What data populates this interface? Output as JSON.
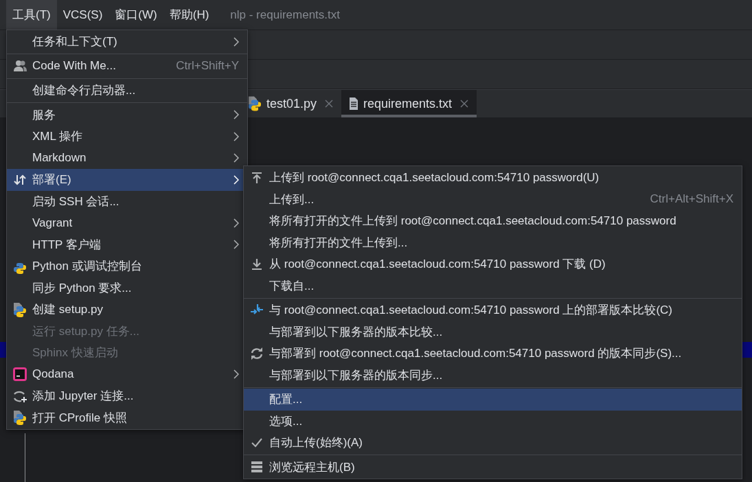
{
  "menu_bar": [
    {
      "label": "工具(T)",
      "selected": true
    },
    {
      "label": "VCS(S)",
      "selected": false
    },
    {
      "label": "窗口(W)",
      "selected": false
    },
    {
      "label": "帮助(H)",
      "selected": false
    }
  ],
  "window": {
    "title": "nlp - requirements.txt"
  },
  "tabs": [
    {
      "label": "test01.py",
      "selected": false
    },
    {
      "label": "requirements.txt",
      "selected": true
    }
  ],
  "tools_menu": {
    "groups": [
      [
        {
          "label": "任务和上下文(T)",
          "submenu": true,
          "disabled": false,
          "selected": false
        }
      ],
      [
        {
          "label": "Code With Me...",
          "shortcut": "Ctrl+Shift+Y",
          "submenu": false,
          "disabled": false,
          "selected": false
        }
      ],
      [
        {
          "label": "创建命令行启动器...",
          "submenu": false,
          "disabled": false,
          "selected": false
        }
      ],
      [
        {
          "label": "服务",
          "submenu": true,
          "disabled": false,
          "selected": false
        },
        {
          "label": "XML 操作",
          "submenu": true,
          "disabled": false,
          "selected": false
        },
        {
          "label": "Markdown",
          "submenu": true,
          "disabled": false,
          "selected": false
        },
        {
          "label": "部署(E)",
          "submenu": true,
          "disabled": false,
          "selected": true
        },
        {
          "label": "启动 SSH 会话...",
          "submenu": false,
          "disabled": false,
          "selected": false
        },
        {
          "label": "Vagrant",
          "submenu": true,
          "disabled": false,
          "selected": false
        },
        {
          "label": "HTTP 客户端",
          "submenu": true,
          "disabled": false,
          "selected": false
        },
        {
          "label": "Python 或调试控制台",
          "submenu": false,
          "disabled": false,
          "selected": false
        },
        {
          "label": "同步 Python 要求...",
          "submenu": false,
          "disabled": false,
          "selected": false
        },
        {
          "label": "创建 setup.py",
          "submenu": false,
          "disabled": false,
          "selected": false
        },
        {
          "label": "运行 setup.py 任务...",
          "submenu": false,
          "disabled": true,
          "selected": false
        },
        {
          "label": "Sphinx 快速启动",
          "submenu": false,
          "disabled": true,
          "selected": false
        },
        {
          "label": "Qodana",
          "submenu": true,
          "disabled": false,
          "selected": false
        },
        {
          "label": "添加 Jupyter 连接...",
          "submenu": false,
          "disabled": false,
          "selected": false
        },
        {
          "label": "打开 CProfile 快照",
          "submenu": false,
          "disabled": false,
          "selected": false
        }
      ]
    ]
  },
  "deployment_submenu": {
    "groups": [
      [
        {
          "label": "上传到 root@connect.cqa1.seetacloud.com:54710 password(U)",
          "checked": false,
          "selected": false
        },
        {
          "label": "上传到...",
          "shortcut": "Ctrl+Alt+Shift+X",
          "checked": false,
          "selected": false
        },
        {
          "label": "将所有打开的文件上传到 root@connect.cqa1.seetacloud.com:54710 password",
          "checked": false,
          "selected": false
        },
        {
          "label": "将所有打开的文件上传到...",
          "checked": false,
          "selected": false
        },
        {
          "label": "从 root@connect.cqa1.seetacloud.com:54710 password 下载 (D)",
          "checked": false,
          "selected": false
        },
        {
          "label": "下载自...",
          "checked": false,
          "selected": false
        }
      ],
      [
        {
          "label": "与 root@connect.cqa1.seetacloud.com:54710 password 上的部署版本比较(C)",
          "checked": false,
          "selected": false
        },
        {
          "label": "与部署到以下服务器的版本比较...",
          "checked": false,
          "selected": false
        },
        {
          "label": "与部署到 root@connect.cqa1.seetacloud.com:54710 password 的版本同步(S)...",
          "checked": false,
          "selected": false
        },
        {
          "label": "与部署到以下服务器的版本同步...",
          "checked": false,
          "selected": false
        }
      ],
      [
        {
          "label": "配置...",
          "checked": false,
          "selected": true
        },
        {
          "label": "选项...",
          "checked": false,
          "selected": false
        },
        {
          "label": "自动上传(始终)(A)",
          "checked": true,
          "selected": false
        }
      ],
      [
        {
          "label": "浏览远程主机(B)",
          "checked": false,
          "selected": false
        }
      ]
    ]
  }
}
